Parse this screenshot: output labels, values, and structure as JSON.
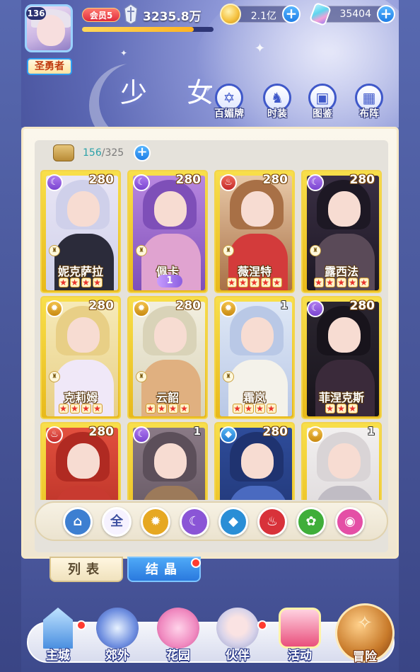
{
  "player": {
    "level": "136",
    "title": "圣勇者",
    "vip": "会员5",
    "power": "3235.8万",
    "xp_progress": 0.85
  },
  "resources": {
    "gold": "2.1亿",
    "gems": "35404"
  },
  "page": {
    "heading": "少 女"
  },
  "tools": [
    {
      "label": "百媚牌",
      "icon": "card-icon"
    },
    {
      "label": "时装",
      "icon": "outfit-icon"
    },
    {
      "label": "图鉴",
      "icon": "book-icon"
    },
    {
      "label": "布阵",
      "icon": "formation-icon"
    }
  ],
  "capacity": {
    "current": "156",
    "separator": "/",
    "max": "325"
  },
  "cards": [
    {
      "name": "妮克萨拉",
      "power": "280",
      "element": "moon",
      "stars": 4
    },
    {
      "name": "佩卡",
      "power": "280",
      "element": "moon",
      "stars": 0,
      "badge": "1"
    },
    {
      "name": "薇涅特",
      "power": "280",
      "element": "fire",
      "stars": 5
    },
    {
      "name": "露西法",
      "power": "280",
      "element": "moon",
      "stars": 5
    },
    {
      "name": "克莉姆",
      "power": "280",
      "element": "sun",
      "stars": 4
    },
    {
      "name": "云韶",
      "power": "280",
      "element": "sun",
      "stars": 4
    },
    {
      "name": "霜岚",
      "power": "1",
      "element": "sun",
      "stars": 4
    },
    {
      "name": "菲涅克斯",
      "power": "280",
      "element": "moon",
      "stars": 3
    },
    {
      "name": "",
      "power": "280",
      "element": "fire",
      "stars": 0
    },
    {
      "name": "",
      "power": "1",
      "element": "moon",
      "stars": 0
    },
    {
      "name": "",
      "power": "280",
      "element": "water",
      "stars": 0
    },
    {
      "name": "",
      "power": "1",
      "element": "sun",
      "stars": 0
    }
  ],
  "filters": [
    {
      "name": "filter-all-icon",
      "label": "",
      "color": "#3d7fd1"
    },
    {
      "name": "filter-all",
      "label": "全",
      "color": "#f6f2ff"
    },
    {
      "name": "filter-sun",
      "label": "",
      "color": "#e6a822"
    },
    {
      "name": "filter-moon",
      "label": "",
      "color": "#8a55d6"
    },
    {
      "name": "filter-water",
      "label": "",
      "color": "#2a8ed6"
    },
    {
      "name": "filter-fire",
      "label": "",
      "color": "#d8323a"
    },
    {
      "name": "filter-wind",
      "label": "",
      "color": "#3fae3a"
    },
    {
      "name": "filter-spirit",
      "label": "",
      "color": "#e44fa6"
    }
  ],
  "tabs": {
    "list": "列表",
    "crystal": "结晶"
  },
  "nav": {
    "main_city": "主城",
    "outskirts": "郊外",
    "garden": "花园",
    "partner": "伙伴",
    "activity": "活动",
    "adventure": "冒险"
  },
  "colors": {
    "card_gold": "#f3d44a",
    "accent_blue": "#2a79de",
    "notice_red": "#ff3b30"
  }
}
